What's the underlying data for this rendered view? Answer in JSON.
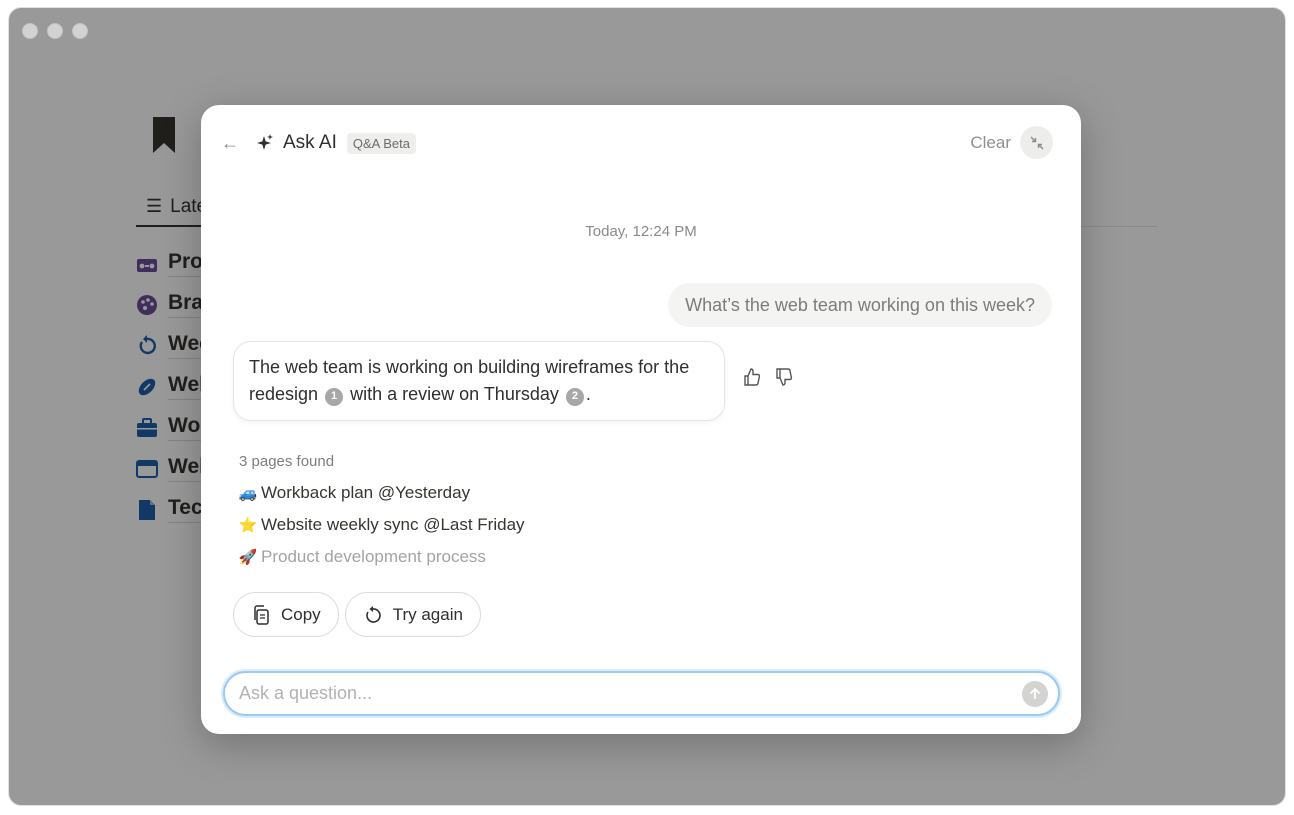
{
  "background_page": {
    "tab_label": "Latest",
    "docs": [
      {
        "icon": "radio-icon",
        "title": "Product"
      },
      {
        "icon": "palette-icon",
        "title": "Brand"
      },
      {
        "icon": "refresh-icon",
        "title": "Weekly"
      },
      {
        "icon": "football-icon",
        "title": "Web"
      },
      {
        "icon": "briefcase-icon",
        "title": "Work"
      },
      {
        "icon": "browser-icon",
        "title": "Website"
      },
      {
        "icon": "document-icon",
        "title": "Tech"
      }
    ]
  },
  "modal": {
    "title": "Ask AI",
    "badge": "Q&A Beta",
    "clear_label": "Clear",
    "timestamp": "Today, 12:24 PM",
    "user_message": "What’s the web team working on this week?",
    "ai_message": {
      "part1": "The web team is working on building wireframes for the redesign",
      "cite1": "1",
      "part2": "with a review on Thursday",
      "cite2": "2",
      "part3": "."
    },
    "pages_found_label": "3 pages found",
    "pages": [
      {
        "emoji": "🚙",
        "title": "Workback plan @Yesterday"
      },
      {
        "emoji": "⭐",
        "title": "Website weekly sync @Last Friday"
      },
      {
        "emoji": "🚀",
        "title": "Product development process"
      }
    ],
    "copy_label": "Copy",
    "try_again_label": "Try again",
    "input_placeholder": "Ask a question..."
  },
  "colors": {
    "overlay": "#666666",
    "input_focus": "#9ccaf3",
    "text_primary": "#2f2f2f"
  }
}
